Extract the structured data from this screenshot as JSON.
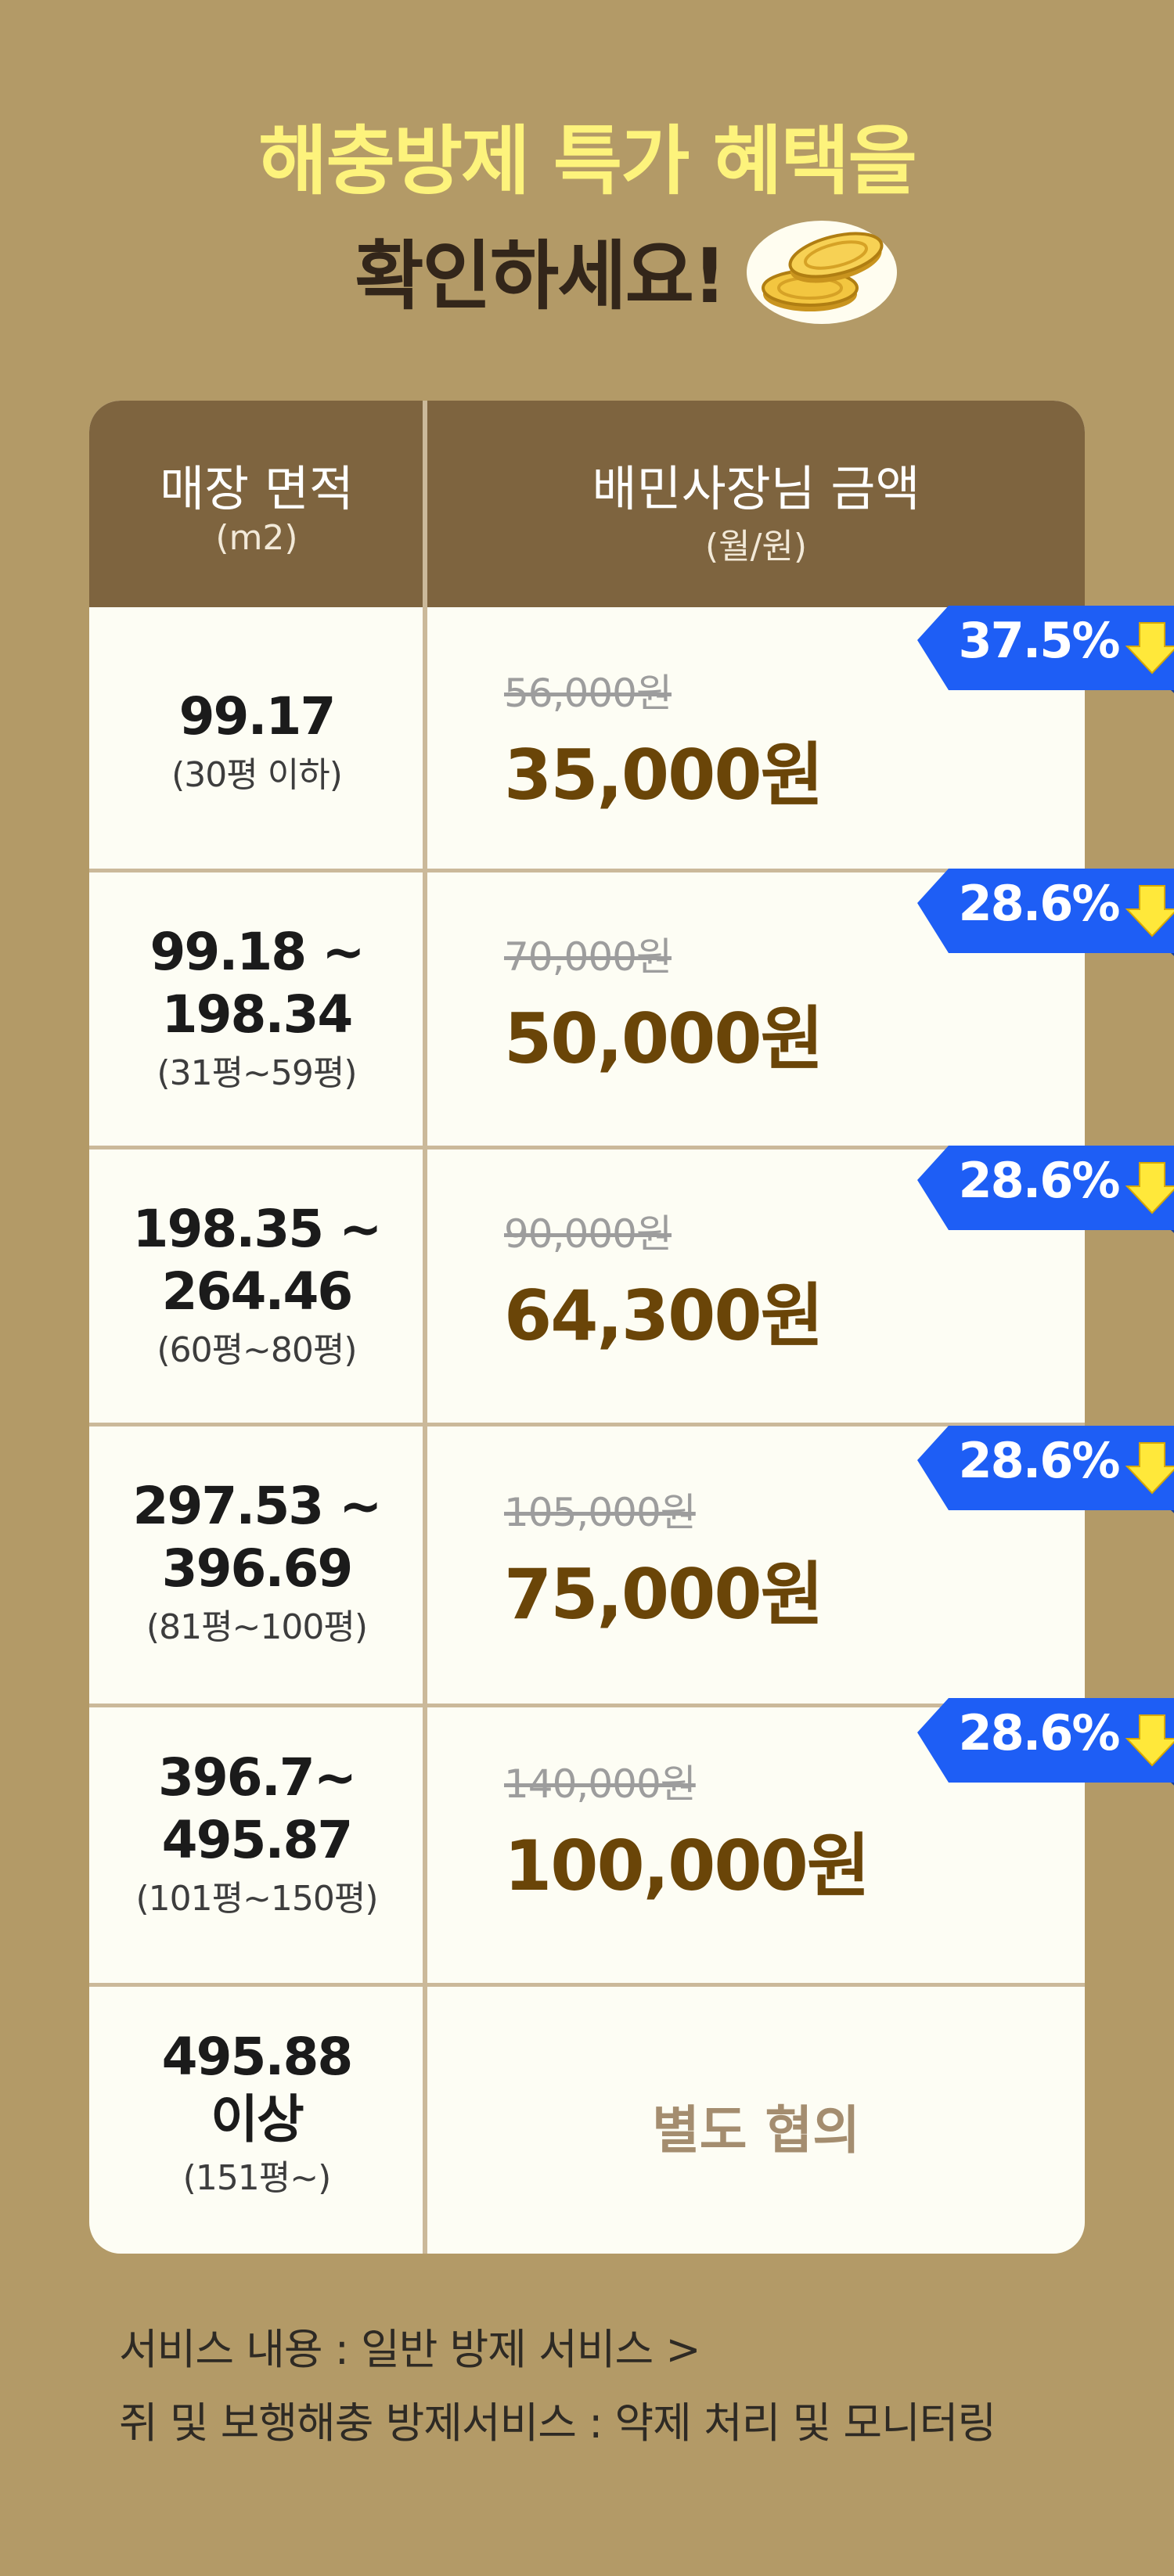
{
  "title": {
    "line1": "해충방제 특가 혜택을",
    "line2": "확인하세요!",
    "icon": "coins-icon"
  },
  "table": {
    "header": {
      "area": "매장 면적",
      "area_unit": "(m2)",
      "price": "배민사장님 금액",
      "price_unit": "(월/원)"
    },
    "rows": [
      {
        "area_line1": "99.17",
        "area_line2": "",
        "pyeong": "(30평 이하)",
        "old_price": "56,000원",
        "new_price": "35,000원",
        "discount": "37.5%"
      },
      {
        "area_line1": "99.18 ~",
        "area_line2": "198.34",
        "pyeong": "(31평~59평)",
        "old_price": "70,000원",
        "new_price": "50,000원",
        "discount": "28.6%"
      },
      {
        "area_line1": "198.35 ~",
        "area_line2": "264.46",
        "pyeong": "(60평~80평)",
        "old_price": "90,000원",
        "new_price": "64,300원",
        "discount": "28.6%"
      },
      {
        "area_line1": "297.53 ~",
        "area_line2": "396.69",
        "pyeong": "(81평~100평)",
        "old_price": "105,000원",
        "new_price": "75,000원",
        "discount": "28.6%"
      },
      {
        "area_line1": "396.7~",
        "area_line2": "495.87",
        "pyeong": "(101평~150평)",
        "old_price": "140,000원",
        "new_price": "100,000원",
        "discount": "28.6%"
      }
    ],
    "last_row": {
      "area_line1": "495.88",
      "area_line2": "이상",
      "pyeong": "(151평~)",
      "price_text": "별도 협의"
    }
  },
  "footer": {
    "line1": "서비스 내용 : 일반 방제 서비스 >",
    "line2": "쥐 및 보행해충 방제서비스 : 약제 처리 및 모니터링"
  },
  "colors": {
    "background": "#b39a67",
    "title_highlight": "#fdf37c",
    "header": "#7e643f",
    "new_price": "#6a4508",
    "badge": "#1e5ef5",
    "arrow": "#ffe83a"
  }
}
